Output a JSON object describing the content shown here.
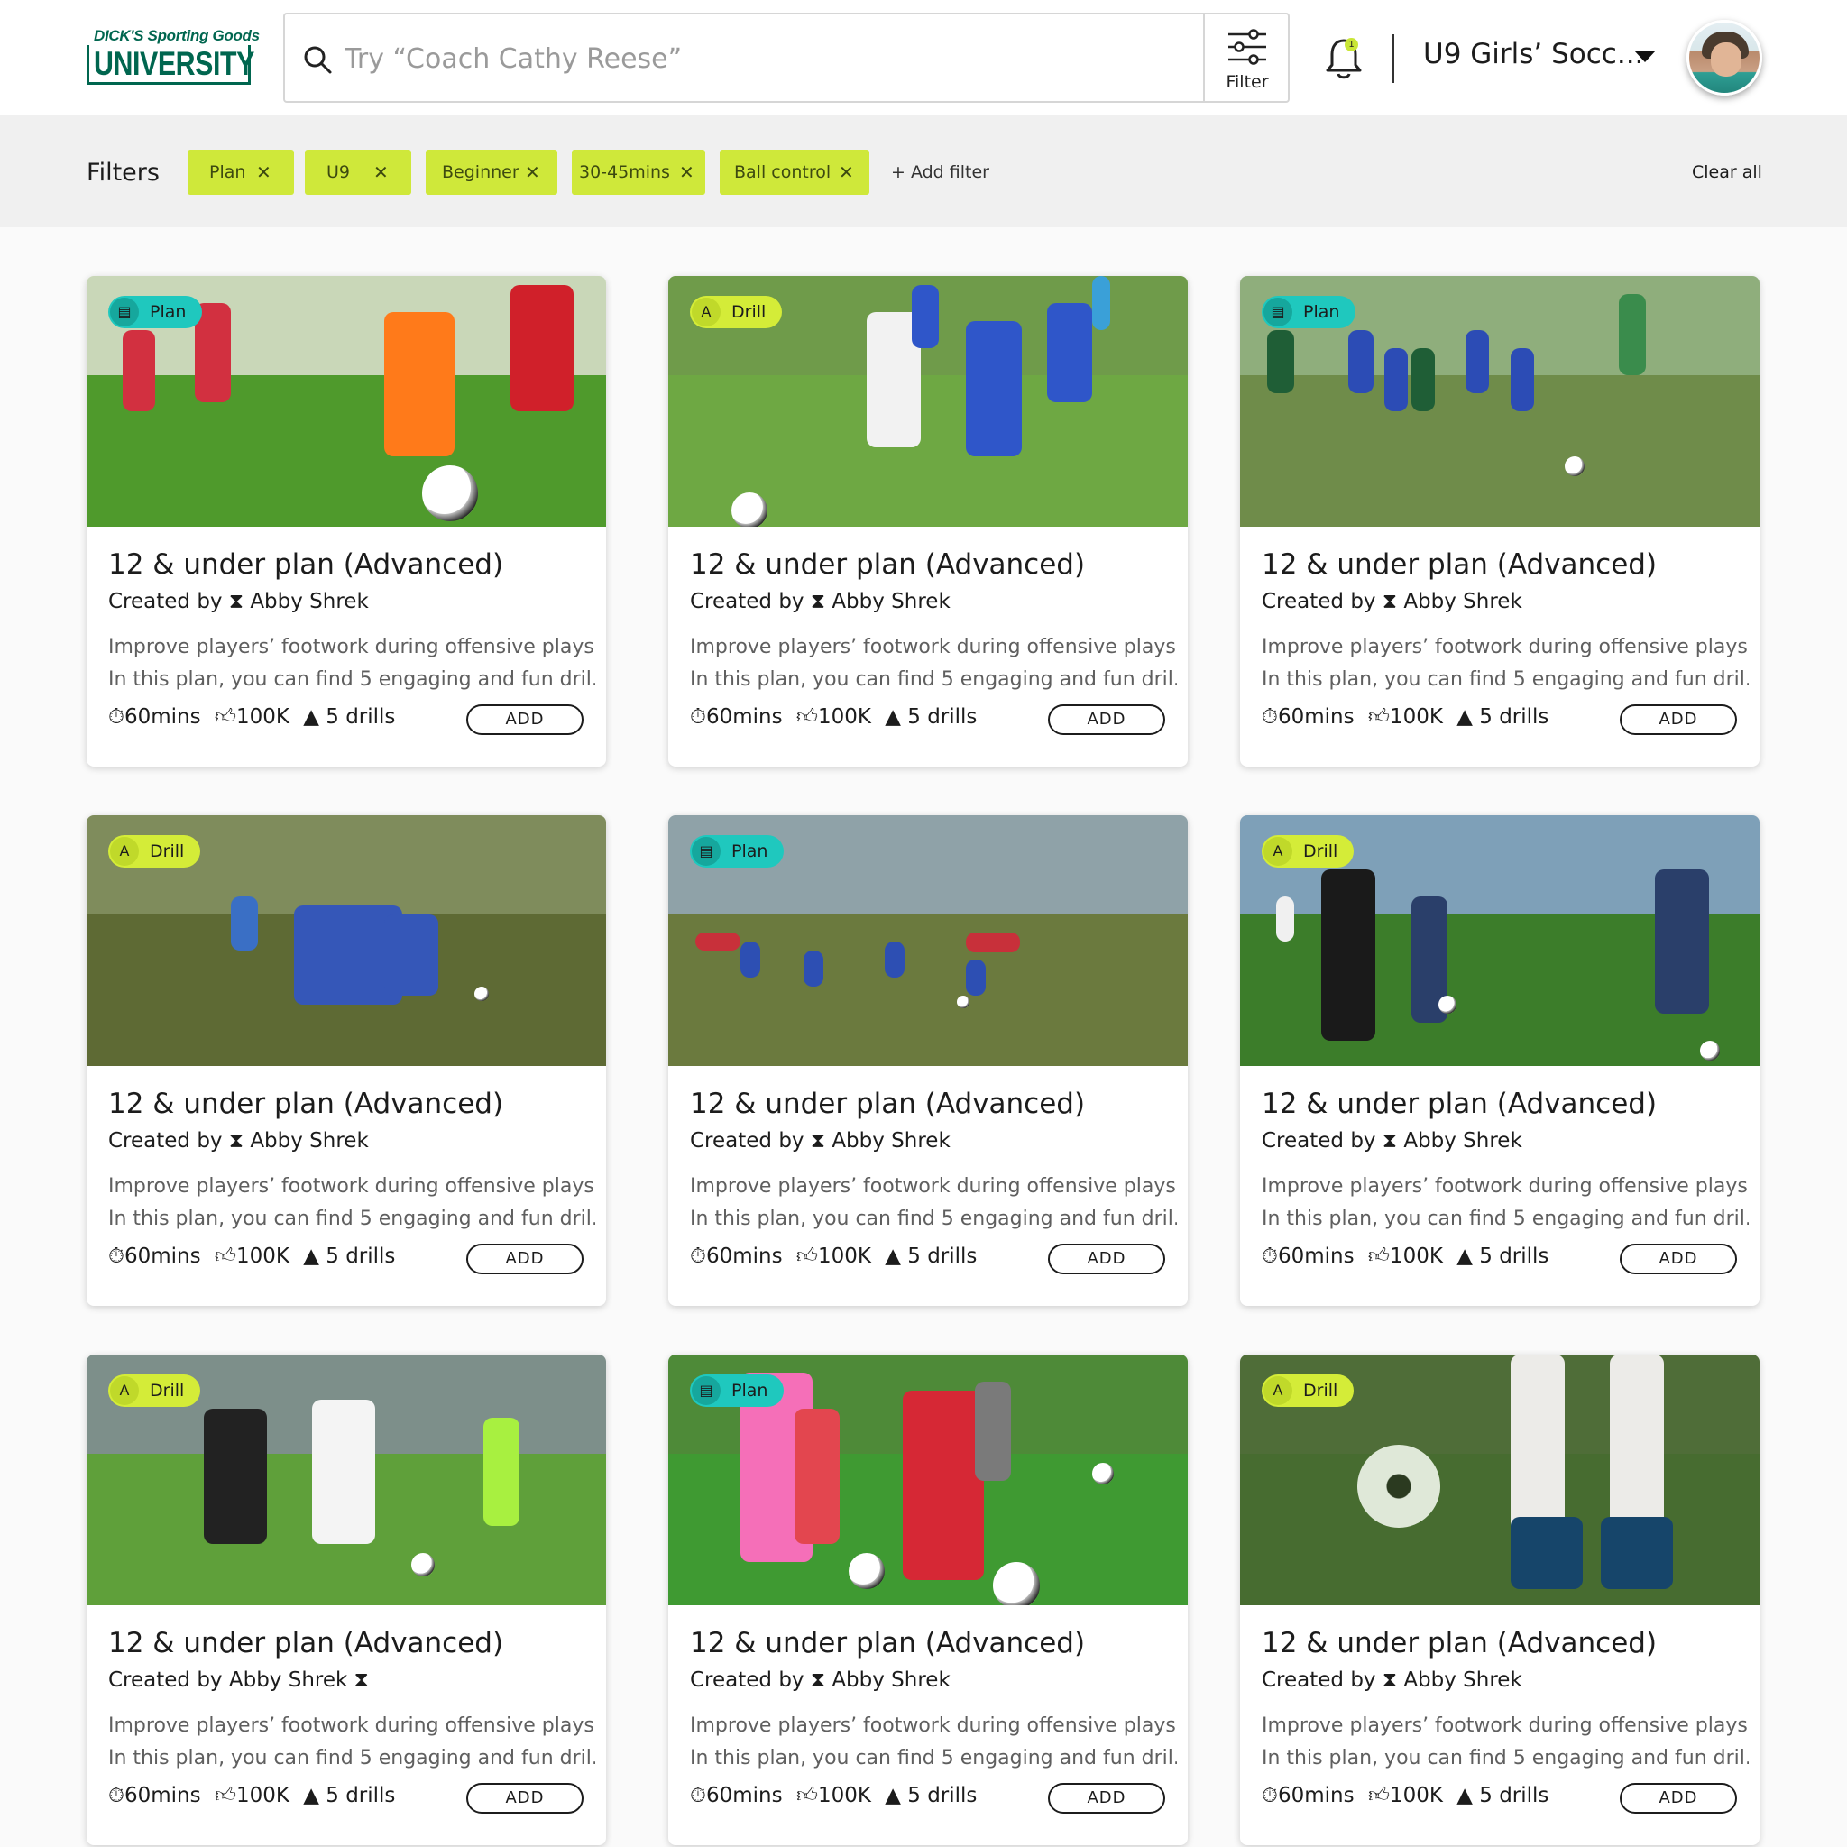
{
  "header": {
    "logo_top": "DICK'S Sporting Goods",
    "logo_word": "UNIVERSITY",
    "search_placeholder": "Try “Coach Cathy Reese”",
    "filter_label": "Filter",
    "notification_count": "1",
    "team_selector": "U9 Girls’ Socc..."
  },
  "filters": {
    "label": "Filters",
    "chips": [
      "Plan",
      "U9",
      "Beginner",
      "30-45mins",
      "Ball control"
    ],
    "add_filter": "+ Add filter",
    "clear_all": "Clear all"
  },
  "cards": [
    {
      "badge": "Plan",
      "badge_icon": "document-icon",
      "title": "12 & under plan (Advanced)",
      "creator_prefix": "Created by",
      "creator": "Abby Shrek",
      "desc1": "Improve players’ footwork during offensive plays.",
      "desc2": "In this plan, you can find 5 engaging and fun dril...",
      "duration": "60mins",
      "likes": "100K",
      "drills": "5 drills",
      "action": "ADD"
    },
    {
      "badge": "Drill",
      "badge_icon": "cone-icon",
      "title": "12 & under plan (Advanced)",
      "creator_prefix": "Created by",
      "creator": "Abby Shrek",
      "desc1": "Improve players’ footwork during offensive plays.",
      "desc2": "In this plan, you can find 5 engaging and fun dril...",
      "duration": "60mins",
      "likes": "100K",
      "drills": "5 drills",
      "action": "ADD"
    },
    {
      "badge": "Plan",
      "badge_icon": "document-icon",
      "title": "12 & under plan (Advanced)",
      "creator_prefix": "Created by",
      "creator": "Abby Shrek",
      "desc1": "Improve players’ footwork during offensive plays.",
      "desc2": "In this plan, you can find 5 engaging and fun dril...",
      "duration": "60mins",
      "likes": "100K",
      "drills": "5 drills",
      "action": "ADD"
    },
    {
      "badge": "Drill",
      "badge_icon": "cone-icon",
      "title": "12 & under plan (Advanced)",
      "creator_prefix": "Created by",
      "creator": "Abby Shrek",
      "desc1": "Improve players’ footwork during offensive plays.",
      "desc2": "In this plan, you can find 5 engaging and fun dril...",
      "duration": "60mins",
      "likes": "100K",
      "drills": "5 drills",
      "action": "ADD"
    },
    {
      "badge": "Plan",
      "badge_icon": "document-icon",
      "title": "12 & under plan (Advanced)",
      "creator_prefix": "Created by",
      "creator": "Abby Shrek",
      "desc1": "Improve players’ footwork during offensive plays.",
      "desc2": "In this plan, you can find 5 engaging and fun dril...",
      "duration": "60mins",
      "likes": "100K",
      "drills": "5 drills",
      "action": "ADD"
    },
    {
      "badge": "Drill",
      "badge_icon": "cone-icon",
      "title": "12 & under plan (Advanced)",
      "creator_prefix": "Created by",
      "creator": "Abby Shrek",
      "desc1": "Improve players’ footwork during offensive plays.",
      "desc2": "In this plan, you can find 5 engaging and fun dril...",
      "duration": "60mins",
      "likes": "100K",
      "drills": "5 drills",
      "action": "ADD"
    },
    {
      "badge": "Drill",
      "badge_icon": "cone-icon",
      "title": "12 & under plan (Advanced)",
      "creator_prefix": "Created by",
      "creator": "Abby Shrek",
      "desc1": "Improve players’ footwork during offensive plays.",
      "desc2": "In this plan, you can find 5 engaging and fun dril...",
      "duration": "60mins",
      "likes": "100K",
      "drills": "5 drills",
      "action": "ADD"
    },
    {
      "badge": "Plan",
      "badge_icon": "document-icon",
      "title": "12 & under plan (Advanced)",
      "creator_prefix": "Created by",
      "creator": "Abby Shrek",
      "desc1": "Improve players’ footwork during offensive plays.",
      "desc2": "In this plan, you can find 5 engaging and fun dril...",
      "duration": "60mins",
      "likes": "100K",
      "drills": "5 drills",
      "action": "ADD"
    },
    {
      "badge": "Drill",
      "badge_icon": "cone-icon",
      "title": "12 & under plan (Advanced)",
      "creator_prefix": "Created by",
      "creator": "Abby Shrek",
      "desc1": "Improve players’ footwork during offensive plays.",
      "desc2": "In this plan, you can find 5 engaging and fun dril...",
      "duration": "60mins",
      "likes": "100K",
      "drills": "5 drills",
      "action": "ADD"
    }
  ],
  "colors": {
    "brand_green": "#00664f",
    "chip_lime": "#cfe83a",
    "plan_teal": "#1fc8be",
    "drill_lime": "#d4ec38"
  }
}
